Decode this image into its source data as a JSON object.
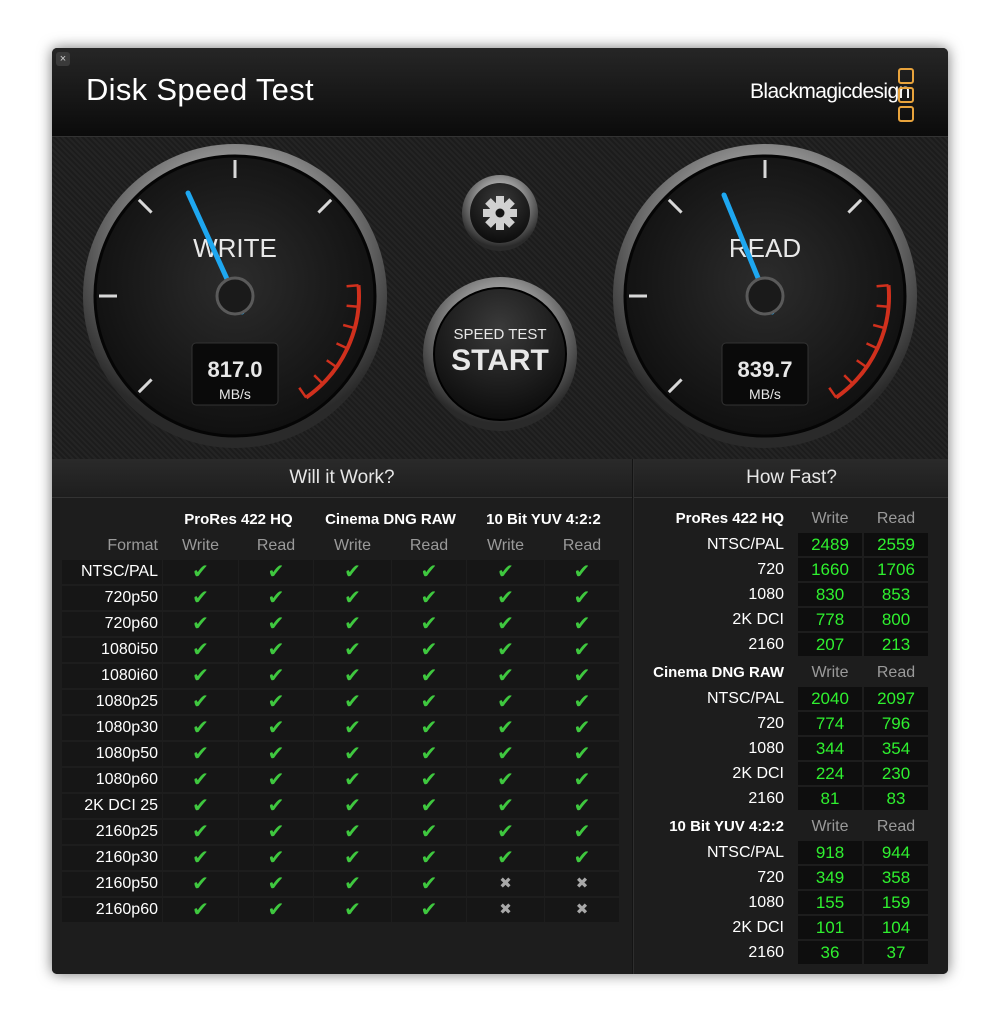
{
  "window": {
    "close_glyph": "×",
    "title": "Disk Speed Test",
    "brand": "Blackmagicdesign",
    "brand_icon": "blackmagic-logo-icon",
    "accent": "#e8a33c"
  },
  "gauges": {
    "write": {
      "label": "WRITE",
      "value": "817.0",
      "unit": "MB/s"
    },
    "read": {
      "label": "READ",
      "value": "839.7",
      "unit": "MB/s"
    },
    "needle_color": "#1ea7f0",
    "redline_color": "#d0301d"
  },
  "controls": {
    "settings_icon": "gear-icon",
    "start_line1": "SPEED TEST",
    "start_line2": "START"
  },
  "will_it_work": {
    "title": "Will it Work?",
    "format_header": "Format",
    "groups": [
      "ProRes 422 HQ",
      "Cinema DNG RAW",
      "10 Bit YUV 4:2:2"
    ],
    "sub_headers": [
      "Write",
      "Read"
    ],
    "rows": [
      {
        "format": "NTSC/PAL",
        "cells": [
          1,
          1,
          1,
          1,
          1,
          1
        ]
      },
      {
        "format": "720p50",
        "cells": [
          1,
          1,
          1,
          1,
          1,
          1
        ]
      },
      {
        "format": "720p60",
        "cells": [
          1,
          1,
          1,
          1,
          1,
          1
        ]
      },
      {
        "format": "1080i50",
        "cells": [
          1,
          1,
          1,
          1,
          1,
          1
        ]
      },
      {
        "format": "1080i60",
        "cells": [
          1,
          1,
          1,
          1,
          1,
          1
        ]
      },
      {
        "format": "1080p25",
        "cells": [
          1,
          1,
          1,
          1,
          1,
          1
        ]
      },
      {
        "format": "1080p30",
        "cells": [
          1,
          1,
          1,
          1,
          1,
          1
        ]
      },
      {
        "format": "1080p50",
        "cells": [
          1,
          1,
          1,
          1,
          1,
          1
        ]
      },
      {
        "format": "1080p60",
        "cells": [
          1,
          1,
          1,
          1,
          1,
          1
        ]
      },
      {
        "format": "2K DCI 25",
        "cells": [
          1,
          1,
          1,
          1,
          1,
          1
        ]
      },
      {
        "format": "2160p25",
        "cells": [
          1,
          1,
          1,
          1,
          1,
          1
        ]
      },
      {
        "format": "2160p30",
        "cells": [
          1,
          1,
          1,
          1,
          1,
          1
        ]
      },
      {
        "format": "2160p50",
        "cells": [
          1,
          1,
          1,
          1,
          0,
          0
        ]
      },
      {
        "format": "2160p60",
        "cells": [
          1,
          1,
          1,
          1,
          0,
          0
        ]
      }
    ],
    "check_glyph": "✔",
    "cross_glyph": "✖"
  },
  "how_fast": {
    "title": "How Fast?",
    "write_label": "Write",
    "read_label": "Read",
    "groups": [
      {
        "name": "ProRes 422 HQ",
        "rows": [
          {
            "label": "NTSC/PAL",
            "write": "2489",
            "read": "2559"
          },
          {
            "label": "720",
            "write": "1660",
            "read": "1706"
          },
          {
            "label": "1080",
            "write": "830",
            "read": "853"
          },
          {
            "label": "2K DCI",
            "write": "778",
            "read": "800"
          },
          {
            "label": "2160",
            "write": "207",
            "read": "213"
          }
        ]
      },
      {
        "name": "Cinema DNG RAW",
        "rows": [
          {
            "label": "NTSC/PAL",
            "write": "2040",
            "read": "2097"
          },
          {
            "label": "720",
            "write": "774",
            "read": "796"
          },
          {
            "label": "1080",
            "write": "344",
            "read": "354"
          },
          {
            "label": "2K DCI",
            "write": "224",
            "read": "230"
          },
          {
            "label": "2160",
            "write": "81",
            "read": "83"
          }
        ]
      },
      {
        "name": "10 Bit YUV 4:2:2",
        "rows": [
          {
            "label": "NTSC/PAL",
            "write": "918",
            "read": "944"
          },
          {
            "label": "720",
            "write": "349",
            "read": "358"
          },
          {
            "label": "1080",
            "write": "155",
            "read": "159"
          },
          {
            "label": "2K DCI",
            "write": "101",
            "read": "104"
          },
          {
            "label": "2160",
            "write": "36",
            "read": "37"
          }
        ]
      }
    ]
  }
}
